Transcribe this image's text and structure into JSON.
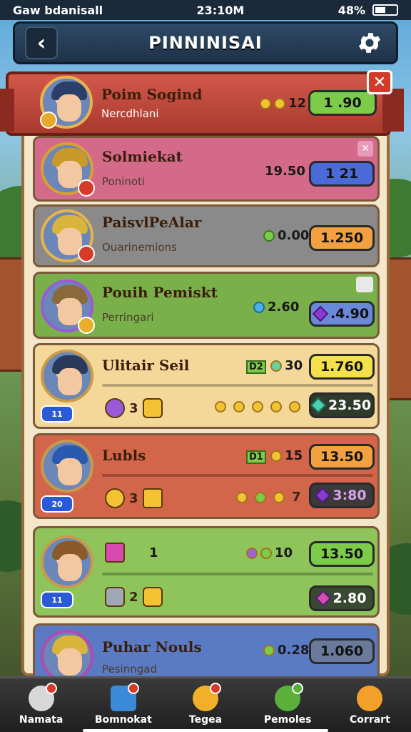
{
  "status": {
    "carrier": "Gaw bdanisall",
    "time": "23:10M",
    "battery": "48%"
  },
  "header": {
    "title": "PINNINISAI",
    "back_icon": "chevron-left-icon",
    "settings_icon": "gear-icon"
  },
  "rows": [
    {
      "name": "Poim Sogind",
      "sub": "Nercdhlani",
      "value": "12",
      "pill": "1 .90",
      "color": "#c94a3e",
      "pill_color": "#7ccc4a"
    },
    {
      "name": "Solmiekat",
      "sub": "Poninoti",
      "value": "19.50",
      "pill": "1 21",
      "color": "#d46a8a",
      "pill_color": "#4a6ad8"
    },
    {
      "name": "PaisvlPeAlar",
      "sub": "Ouarinemions",
      "value": "0.00",
      "pill": "1.250",
      "color": "#8a8a8a",
      "pill_color": "#f2a040"
    },
    {
      "name": "Pouih Pemiskt",
      "sub": "Perringari",
      "value": "2.60",
      "pill": ".4.90",
      "color": "#7ab04a",
      "pill_color": "#6a88d8"
    },
    {
      "name": "Ulitair Seil",
      "sub": "",
      "value": "30",
      "pill": "1.760",
      "pill2": "23.50",
      "tag": "D2",
      "count1": "11",
      "count2": "3",
      "color": "#f4d89a",
      "pill_color": "#f4e04a"
    },
    {
      "name": "Lubls",
      "sub": "",
      "value": "15",
      "pill": "13.50",
      "pill2": "3:80",
      "tag": "D1",
      "count1": "20",
      "count2": "3",
      "count3": "7",
      "color": "#d2654a",
      "pill_color": "#f2a040"
    },
    {
      "name": "",
      "sub": "",
      "value": "10",
      "pill": "13.50",
      "pill2": "2.80",
      "count1": "11",
      "count2": "2",
      "count3": "1",
      "color": "#8ec45a",
      "pill_color": "#7ccc4a"
    },
    {
      "name": "Puhar Nouls",
      "sub": "Pesinngad",
      "value": "0.28",
      "pill": "1.060",
      "color": "#5a7ac4",
      "pill_color": "#6a7a9a"
    }
  ],
  "tabs": [
    {
      "label": "Namata",
      "icon": "profile-icon",
      "badge": true
    },
    {
      "label": "Bomnokat",
      "icon": "home-icon",
      "badge": true
    },
    {
      "label": "Tegea",
      "icon": "shop-icon",
      "badge": true
    },
    {
      "label": "Pemoles",
      "icon": "gem-icon",
      "badge": true
    },
    {
      "label": "Corrart",
      "icon": "coin-icon",
      "badge": false
    }
  ]
}
